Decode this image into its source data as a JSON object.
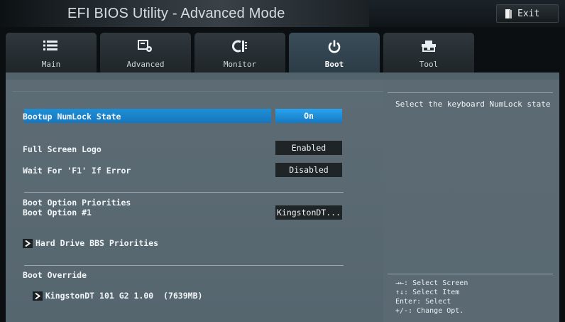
{
  "app": {
    "title": "EFI BIOS Utility - Advanced Mode",
    "exit_label": "Exit"
  },
  "tabs": [
    {
      "label": "Main",
      "icon": "list-icon",
      "active": false
    },
    {
      "label": "Advanced",
      "icon": "advanced-icon",
      "active": false
    },
    {
      "label": "Monitor",
      "icon": "monitor-icon",
      "active": false
    },
    {
      "label": "Boot",
      "icon": "power-icon",
      "active": true
    },
    {
      "label": "Tool",
      "icon": "tool-icon",
      "active": false
    }
  ],
  "settings": {
    "numlock": {
      "label": "Bootup NumLock State",
      "value": "On"
    },
    "full_screen_logo": {
      "label": "Full Screen Logo",
      "value": "Enabled"
    },
    "wait_f1": {
      "label": "Wait For 'F1' If Error",
      "value": "Disabled"
    },
    "boot_option_priorities": {
      "label": "Boot Option Priorities"
    },
    "boot_option_1": {
      "label": "Boot Option #1",
      "value": "KingstonDT..."
    },
    "hdd_bbs": {
      "label": "Hard Drive BBS Priorities"
    },
    "boot_override": {
      "label": "Boot Override",
      "item": "KingstonDT 101 G2 1.00  (7639MB)"
    }
  },
  "help": {
    "description": "Select the keyboard NumLock state",
    "keys": [
      "→←: Select Screen",
      "↑↓: Select Item",
      "Enter: Select",
      "+/-: Change Opt."
    ]
  },
  "colors": {
    "accent": "#1e8fd5",
    "panel": "#5d6c74",
    "value_box": "#1f2427"
  }
}
